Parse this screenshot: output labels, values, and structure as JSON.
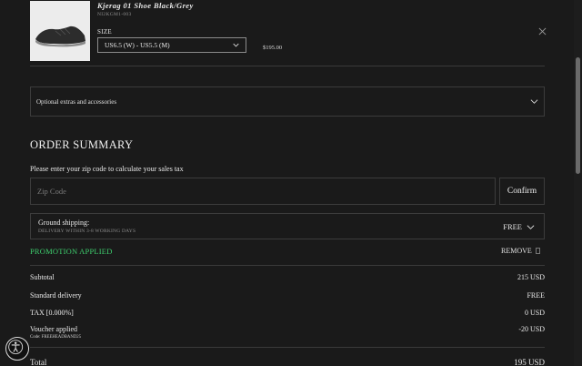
{
  "product": {
    "name": "Kjerag 01 Shoe Black/Grey",
    "sku": "NI2KGM1-003",
    "size_label": "SIZE",
    "size_value": "US6.5 (W) - US5.5 (M)",
    "price": "$195.00"
  },
  "accordion": {
    "label": "Optional extras and accessories"
  },
  "summary": {
    "title": "ORDER SUMMARY",
    "zip_prompt": "Please enter your zip code to calculate your sales tax",
    "zip_placeholder": "Zip Code",
    "confirm_label": "Confirm",
    "shipping": {
      "title": "Ground shipping:",
      "subtitle": "DELIVERY WITHIN 3-8 WORKING DAYS",
      "value": "FREE"
    },
    "promo_label": "PROMOTION APPLIED",
    "remove_label": "REMOVE",
    "rows": {
      "subtotal": {
        "label": "Subtotal",
        "value": "215 USD"
      },
      "delivery": {
        "label": "Standard delivery",
        "value": "FREE"
      },
      "tax": {
        "label": "TAX [0.000%]",
        "value": "0 USD"
      },
      "voucher": {
        "label": "Voucher applied",
        "code": "Code: FREEHEADBAND25",
        "value": "-20 USD"
      },
      "total": {
        "label": "Total",
        "value": "195 USD"
      }
    }
  },
  "colors": {
    "background": "#1a1a1a",
    "promo": "#3ecf6e",
    "border": "#3c3c3c"
  },
  "icons": {
    "close": "close-icon",
    "chevron": "chevron-down-icon",
    "accessibility": "accessibility-icon"
  }
}
